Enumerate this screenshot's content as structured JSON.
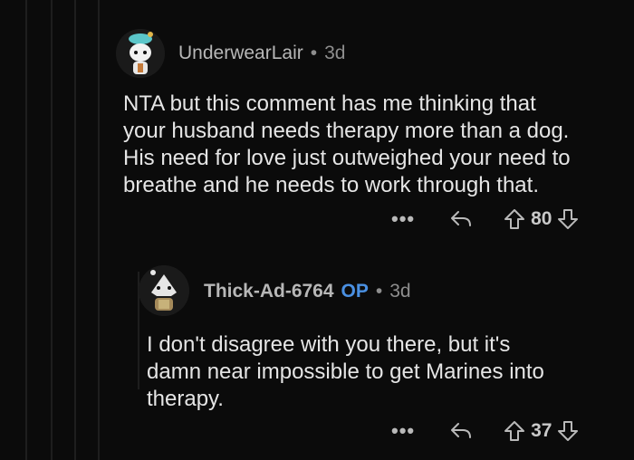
{
  "comments": [
    {
      "username": "UnderwearLair",
      "separator": "•",
      "age": "3d",
      "body": [
        "NTA but this comment has me thinking that",
        "your husband needs therapy more than a dog.",
        "His need for love just outweighed your need to",
        "breathe and he needs to work through that."
      ],
      "more": "•••",
      "votes": "80",
      "icons": {
        "avatar": "snoo-avatar-icon",
        "more": "more-options-icon",
        "reply": "reply-icon",
        "upvote": "upvote-arrow-icon",
        "downvote": "downvote-arrow-icon"
      }
    },
    {
      "username": "Thick-Ad-6764",
      "op_badge": "OP",
      "separator": "•",
      "age": "3d",
      "body": [
        "I don't disagree with you there, but it's",
        "damn near impossible to get Marines into",
        "therapy."
      ],
      "more": "•••",
      "votes": "37",
      "icons": {
        "avatar": "snoo-avatar-icon",
        "more": "more-options-icon",
        "reply": "reply-icon",
        "upvote": "upvote-arrow-icon",
        "downvote": "downvote-arrow-icon"
      }
    }
  ],
  "colors": {
    "background": "#0b0b0b",
    "op": "#4a90e2",
    "text": "#e5e5e5",
    "muted": "#8e8e8e"
  }
}
